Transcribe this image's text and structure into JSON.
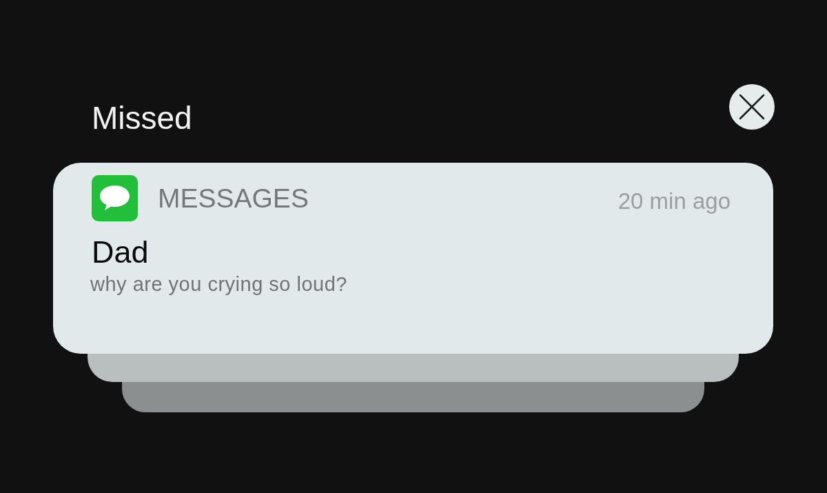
{
  "section_title": "Missed",
  "notification": {
    "app": "MESSAGES",
    "time": "20 min ago",
    "sender": "Dad",
    "message": "why are you crying so loud?"
  }
}
